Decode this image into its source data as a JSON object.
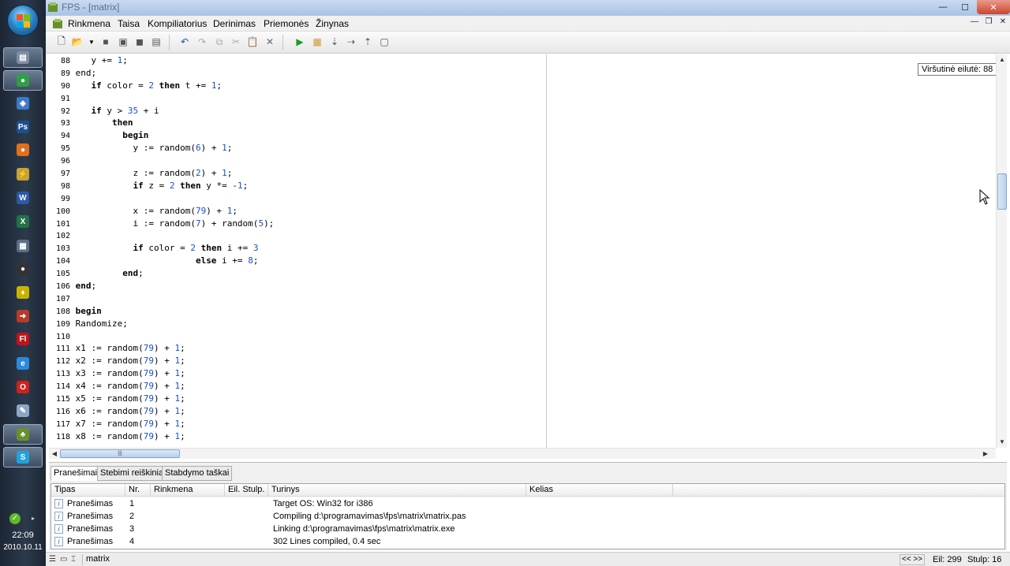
{
  "window": {
    "title": "FPS - [matrix]"
  },
  "menu": [
    "Rinkmena",
    "Taisa",
    "Kompiliatorius",
    "Derinimas",
    "Priemonės",
    "Žinynas"
  ],
  "taskbar": {
    "apps": [
      {
        "name": "explorer-icon",
        "color": "#7e8fa5",
        "glyph": "▤"
      },
      {
        "name": "chrome-icon",
        "color": "#2f9e45",
        "glyph": "●"
      },
      {
        "name": "virtualbox-icon",
        "color": "#3f79c7",
        "glyph": "◈"
      },
      {
        "name": "photoshop-icon",
        "color": "#1d4f8f",
        "glyph": "Ps"
      },
      {
        "name": "firefox-icon",
        "color": "#e0701c",
        "glyph": "●"
      },
      {
        "name": "winamp-icon",
        "color": "#c7a336",
        "glyph": "⚡"
      },
      {
        "name": "word-icon",
        "color": "#2a5aa8",
        "glyph": "W"
      },
      {
        "name": "excel-icon",
        "color": "#217346",
        "glyph": "X"
      },
      {
        "name": "calculator-icon",
        "color": "#5c6f86",
        "glyph": "▦"
      },
      {
        "name": "media-icon",
        "color": "#333",
        "glyph": "●"
      },
      {
        "name": "tool-icon",
        "color": "#c8b400",
        "glyph": "♦"
      },
      {
        "name": "filezilla-icon",
        "color": "#b63b2b",
        "glyph": "➜"
      },
      {
        "name": "flash-icon",
        "color": "#c4121a",
        "glyph": "Fl"
      },
      {
        "name": "ie-icon",
        "color": "#2b8ad9",
        "glyph": "e"
      },
      {
        "name": "opera-icon",
        "color": "#d0211b",
        "glyph": "O"
      },
      {
        "name": "notepad-icon",
        "color": "#8ea6c6",
        "glyph": "✎"
      },
      {
        "name": "fps-icon",
        "color": "#6a8f2e",
        "glyph": "♣"
      },
      {
        "name": "skype-icon",
        "color": "#1fa3e0",
        "glyph": "S"
      }
    ],
    "clock_time": "22:09",
    "clock_date": "2010.10.11"
  },
  "editor": {
    "tooltip": "Viršutinė eilutė: 88",
    "lines": [
      {
        "n": "88",
        "code": [
          [
            "   y += ",
            ""
          ],
          [
            "1",
            "num"
          ],
          [
            ";",
            ""
          ]
        ]
      },
      {
        "n": "89",
        "code": [
          [
            "end",
            ""
          ],
          [
            ";",
            ""
          ]
        ]
      },
      {
        "n": "90",
        "code": [
          [
            "   if",
            "kw"
          ],
          [
            " color = ",
            ""
          ],
          [
            "2",
            "num"
          ],
          [
            " ",
            ""
          ],
          [
            "then",
            "kw"
          ],
          [
            " t += ",
            ""
          ],
          [
            "1",
            "num"
          ],
          [
            ";",
            ""
          ]
        ]
      },
      {
        "n": "91",
        "code": []
      },
      {
        "n": "92",
        "code": [
          [
            "   if",
            "kw"
          ],
          [
            " y > ",
            ""
          ],
          [
            "35",
            "num"
          ],
          [
            " + i",
            ""
          ]
        ]
      },
      {
        "n": "93",
        "code": [
          [
            "       then",
            "kw"
          ]
        ]
      },
      {
        "n": "94",
        "code": [
          [
            "         begin",
            "kw"
          ]
        ]
      },
      {
        "n": "95",
        "code": [
          [
            "           y := random(",
            ""
          ],
          [
            "6",
            "num"
          ],
          [
            ") + ",
            ""
          ],
          [
            "1",
            "num"
          ],
          [
            ";",
            ""
          ]
        ]
      },
      {
        "n": "96",
        "code": []
      },
      {
        "n": "97",
        "code": [
          [
            "           z := random(",
            ""
          ],
          [
            "2",
            "num"
          ],
          [
            ") + ",
            ""
          ],
          [
            "1",
            "num"
          ],
          [
            ";",
            ""
          ]
        ]
      },
      {
        "n": "98",
        "code": [
          [
            "           if",
            "kw"
          ],
          [
            " z = ",
            ""
          ],
          [
            "2",
            "num"
          ],
          [
            " ",
            ""
          ],
          [
            "then",
            "kw"
          ],
          [
            " y *= -",
            ""
          ],
          [
            "1",
            "num"
          ],
          [
            ";",
            ""
          ]
        ]
      },
      {
        "n": "99",
        "code": []
      },
      {
        "n": "100",
        "code": [
          [
            "           x := random(",
            ""
          ],
          [
            "79",
            "num"
          ],
          [
            ") + ",
            ""
          ],
          [
            "1",
            "num"
          ],
          [
            ";",
            ""
          ]
        ]
      },
      {
        "n": "101",
        "code": [
          [
            "           i := random(",
            ""
          ],
          [
            "7",
            "num"
          ],
          [
            ") + random(",
            ""
          ],
          [
            "5",
            "num"
          ],
          [
            ");",
            ""
          ]
        ]
      },
      {
        "n": "102",
        "code": []
      },
      {
        "n": "103",
        "code": [
          [
            "           if",
            "kw"
          ],
          [
            " color = ",
            ""
          ],
          [
            "2",
            "num"
          ],
          [
            " ",
            ""
          ],
          [
            "then",
            "kw"
          ],
          [
            " i += ",
            ""
          ],
          [
            "3",
            "num"
          ]
        ]
      },
      {
        "n": "104",
        "code": [
          [
            "                       else",
            "kw"
          ],
          [
            " i += ",
            ""
          ],
          [
            "8",
            "num"
          ],
          [
            ";",
            ""
          ]
        ]
      },
      {
        "n": "105",
        "code": [
          [
            "         end",
            "kw"
          ],
          [
            ";",
            ""
          ]
        ]
      },
      {
        "n": "106",
        "code": [
          [
            "end",
            "kw"
          ],
          [
            ";",
            ""
          ]
        ]
      },
      {
        "n": "107",
        "code": []
      },
      {
        "n": "108",
        "code": [
          [
            "begin",
            "kw"
          ]
        ]
      },
      {
        "n": "109",
        "code": [
          [
            "Randomize;",
            ""
          ]
        ]
      },
      {
        "n": "110",
        "code": []
      },
      {
        "n": "111",
        "code": [
          [
            "x1 := random(",
            ""
          ],
          [
            "79",
            "num"
          ],
          [
            ") + ",
            ""
          ],
          [
            "1",
            "num"
          ],
          [
            ";",
            ""
          ]
        ]
      },
      {
        "n": "112",
        "code": [
          [
            "x2 := random(",
            ""
          ],
          [
            "79",
            "num"
          ],
          [
            ") + ",
            ""
          ],
          [
            "1",
            "num"
          ],
          [
            ";",
            ""
          ]
        ]
      },
      {
        "n": "113",
        "code": [
          [
            "x3 := random(",
            ""
          ],
          [
            "79",
            "num"
          ],
          [
            ") + ",
            ""
          ],
          [
            "1",
            "num"
          ],
          [
            ";",
            ""
          ]
        ]
      },
      {
        "n": "114",
        "code": [
          [
            "x4 := random(",
            ""
          ],
          [
            "79",
            "num"
          ],
          [
            ") + ",
            ""
          ],
          [
            "1",
            "num"
          ],
          [
            ";",
            ""
          ]
        ]
      },
      {
        "n": "115",
        "code": [
          [
            "x5 := random(",
            ""
          ],
          [
            "79",
            "num"
          ],
          [
            ") + ",
            ""
          ],
          [
            "1",
            "num"
          ],
          [
            ";",
            ""
          ]
        ]
      },
      {
        "n": "116",
        "code": [
          [
            "x6 := random(",
            ""
          ],
          [
            "79",
            "num"
          ],
          [
            ") + ",
            ""
          ],
          [
            "1",
            "num"
          ],
          [
            ";",
            ""
          ]
        ]
      },
      {
        "n": "117",
        "code": [
          [
            "x7 := random(",
            ""
          ],
          [
            "79",
            "num"
          ],
          [
            ") + ",
            ""
          ],
          [
            "1",
            "num"
          ],
          [
            ";",
            ""
          ]
        ]
      },
      {
        "n": "118",
        "code": [
          [
            "x8 := random(",
            ""
          ],
          [
            "79",
            "num"
          ],
          [
            ") + ",
            ""
          ],
          [
            "1",
            "num"
          ],
          [
            ";",
            ""
          ]
        ]
      }
    ]
  },
  "tabs": [
    "Pranešimai",
    "Stebimi reiškiniai",
    "Stabdymo taškai"
  ],
  "messages": {
    "columns": [
      "Tipas",
      "Nr.",
      "Rinkmena",
      "Eil. Stulp.",
      "Turinys",
      "Kelias"
    ],
    "rows": [
      {
        "type": "Pranešimas",
        "nr": "1",
        "content": "Target OS: Win32 for i386"
      },
      {
        "type": "Pranešimas",
        "nr": "2",
        "content": "Compiling d:\\programavimas\\fps\\matrix\\matrix.pas"
      },
      {
        "type": "Pranešimas",
        "nr": "3",
        "content": "Linking d:\\programavimas\\fps\\matrix\\matrix.exe"
      },
      {
        "type": "Pranešimas",
        "nr": "4",
        "content": "302 Lines compiled, 0.4 sec"
      }
    ]
  },
  "statusbar": {
    "file": "matrix",
    "nav": "<< >>",
    "line": "Eil: 299",
    "col": "Stulp:  16"
  }
}
